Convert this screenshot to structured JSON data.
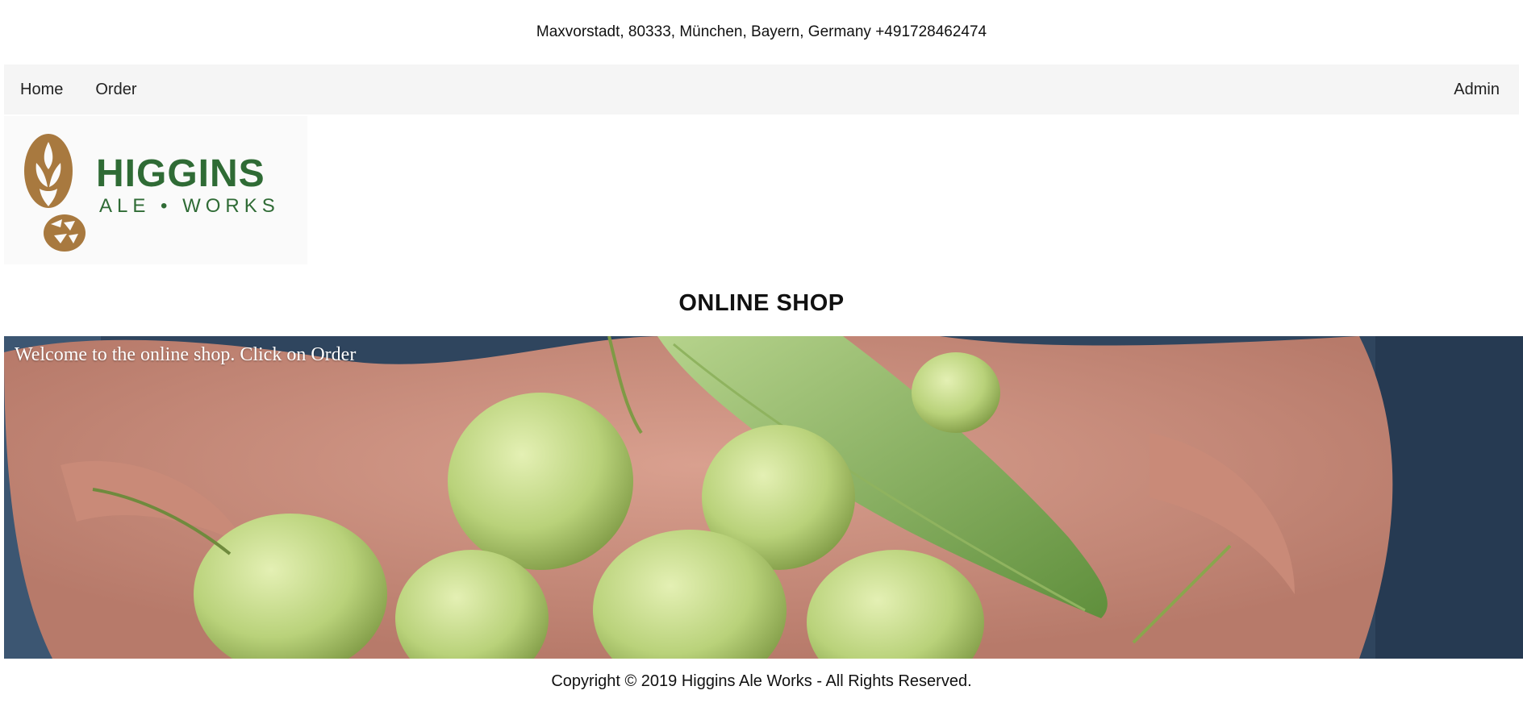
{
  "header": {
    "address": "Maxvorstadt, 80333, München, Bayern, Germany +491728462474"
  },
  "nav": {
    "home": "Home",
    "order": "Order",
    "admin": "Admin"
  },
  "logo": {
    "word1": "HIGGINS",
    "word2": "ALE • WORKS",
    "brand_green": "#2f6b35",
    "brand_brown": "#a8793f"
  },
  "page": {
    "title": "ONLINE SHOP"
  },
  "hero": {
    "welcome": "Welcome to the online shop. Click on Order"
  },
  "footer": {
    "copyright": "Copyright © 2019 Higgins Ale Works - All Rights Reserved."
  }
}
